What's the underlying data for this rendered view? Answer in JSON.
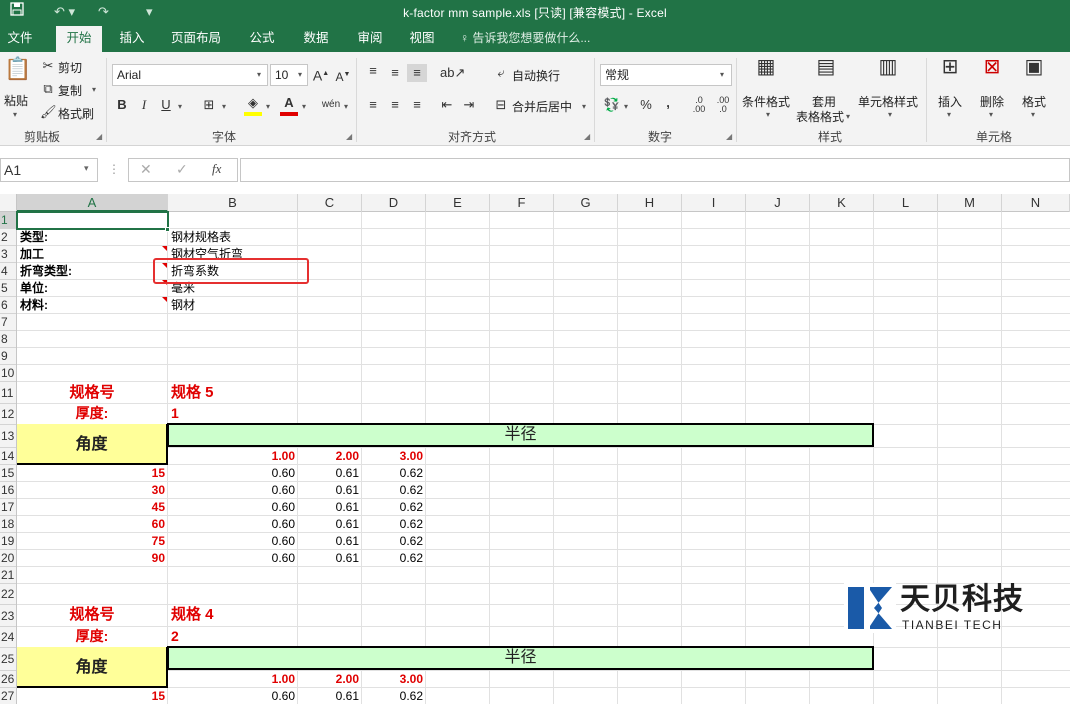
{
  "window": {
    "title": "k-factor mm sample.xls  [只读]  [兼容模式] - Excel"
  },
  "tabs": [
    "文件",
    "开始",
    "插入",
    "页面布局",
    "公式",
    "数据",
    "审阅",
    "视图"
  ],
  "tell_me": "告诉我您想要做什么...",
  "ribbon": {
    "clipboard": {
      "paste": "粘贴",
      "cut": "剪切",
      "copy": "复制",
      "format_painter": "格式刷",
      "label": "剪贴板"
    },
    "font": {
      "name": "Arial",
      "size": "10",
      "bold": "B",
      "italic": "I",
      "underline": "U",
      "label": "字体"
    },
    "alignment": {
      "wrap": "自动换行",
      "merge": "合并后居中",
      "label": "对齐方式"
    },
    "number": {
      "format": "常规",
      "percent": "%",
      "comma": ",",
      "label": "数字"
    },
    "styles": {
      "conditional": "条件格式",
      "table": "套用",
      "table2": "表格格式",
      "cell_styles": "单元格样式",
      "label": "样式"
    },
    "cells": {
      "insert": "插入",
      "delete": "删除",
      "format": "格式",
      "label": "单元格"
    }
  },
  "formula_bar": {
    "name_box": "A1",
    "fx": "fx",
    "content": ""
  },
  "columns": [
    "A",
    "B",
    "C",
    "D",
    "E",
    "F",
    "G",
    "H",
    "I",
    "J",
    "K",
    "L",
    "M",
    "N"
  ],
  "rows": [
    "1",
    "2",
    "3",
    "4",
    "5",
    "6",
    "7",
    "8",
    "9",
    "10",
    "11",
    "12",
    "13",
    "14",
    "15",
    "16",
    "17",
    "18",
    "19",
    "20",
    "21",
    "22",
    "23",
    "24",
    "25",
    "26",
    "27"
  ],
  "info": {
    "type_label": "类型:",
    "type_value": "钢材规格表",
    "process_label": "加工",
    "process_value": "钢材空气折弯",
    "bend_label": "折弯类型:",
    "bend_value": "折弯系数",
    "unit_label": "单位:",
    "unit_value": "毫米",
    "material_label": "材料:",
    "material_value": "钢材"
  },
  "blocks": [
    {
      "spec_label": "规格号",
      "spec_value": "规格 5",
      "thick_label": "厚度:",
      "thick_value": "1",
      "angle_label": "角度",
      "radius_label": "半径",
      "radii": [
        "1.00",
        "2.00",
        "3.00"
      ],
      "rows": [
        {
          "angle": "15",
          "vals": [
            "0.60",
            "0.61",
            "0.62"
          ]
        },
        {
          "angle": "30",
          "vals": [
            "0.60",
            "0.61",
            "0.62"
          ]
        },
        {
          "angle": "45",
          "vals": [
            "0.60",
            "0.61",
            "0.62"
          ]
        },
        {
          "angle": "60",
          "vals": [
            "0.60",
            "0.61",
            "0.62"
          ]
        },
        {
          "angle": "75",
          "vals": [
            "0.60",
            "0.61",
            "0.62"
          ]
        },
        {
          "angle": "90",
          "vals": [
            "0.60",
            "0.61",
            "0.62"
          ]
        }
      ]
    },
    {
      "spec_label": "规格号",
      "spec_value": "规格 4",
      "thick_label": "厚度:",
      "thick_value": "2",
      "angle_label": "角度",
      "radius_label": "半径",
      "radii": [
        "1.00",
        "2.00",
        "3.00"
      ],
      "rows": [
        {
          "angle": "15",
          "vals": [
            "0.60",
            "0.61",
            "0.62"
          ]
        }
      ]
    }
  ],
  "watermark": {
    "name": "天贝科技",
    "sub": "TIANBEI TECH"
  },
  "colors": {
    "excel_green": "#217346",
    "red": "#e00000",
    "yellow": "#ffff99",
    "green_fill": "#ccffcc"
  }
}
